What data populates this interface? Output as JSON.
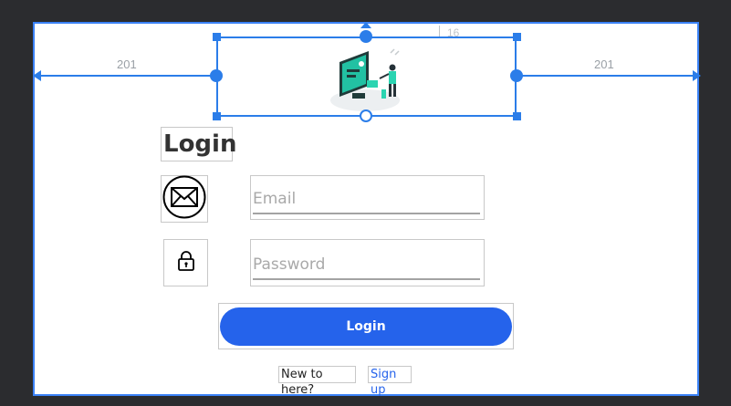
{
  "measurements": {
    "left_spacing": "201",
    "right_spacing": "201",
    "top_spacing": "16"
  },
  "login_form": {
    "title": "Login",
    "email_placeholder": "Email",
    "password_placeholder": "Password",
    "login_button": "Login",
    "new_here_text": "New to here?",
    "signup_link": "Sign up"
  },
  "icons": {
    "email": "envelope-icon",
    "password": "lock-icon",
    "illustration": "computer-user-illustration"
  },
  "colors": {
    "selection": "#2b7de9",
    "button": "#2563eb",
    "link": "#2563eb",
    "background": "#2b2c2f"
  }
}
